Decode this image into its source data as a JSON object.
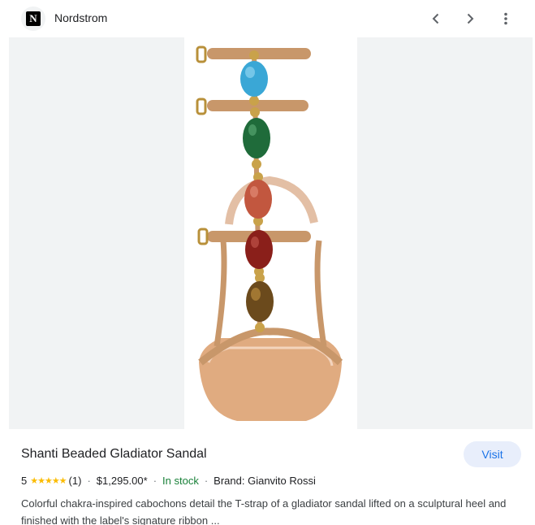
{
  "header": {
    "logo_letter": "N",
    "site_name": "Nordstrom"
  },
  "product": {
    "title": "Shanti Beaded Gladiator Sandal",
    "visit_label": "Visit",
    "rating": "5",
    "stars": "★★★★★",
    "review_count": "(1)",
    "price": "$1,295.00*",
    "stock": "In stock",
    "brand": "Brand: Gianvito Rossi",
    "description": "Colorful chakra-inspired cabochons detail the T-strap of a gladiator sandal lifted on a sculptural heel and finished with the label's signature ribbon ..."
  },
  "separator": "·",
  "colors": {
    "accent": "#1a73e8",
    "stock": "#188038",
    "star": "#fbbc04",
    "strap": "#c8976a",
    "stones": [
      "#3aa7d6",
      "#1f6b3a",
      "#c2573f",
      "#8a1f1a",
      "#6b4a1c"
    ]
  },
  "icons": {
    "back": "chevron-left-icon",
    "forward": "chevron-right-icon",
    "more": "more-vert-icon"
  }
}
